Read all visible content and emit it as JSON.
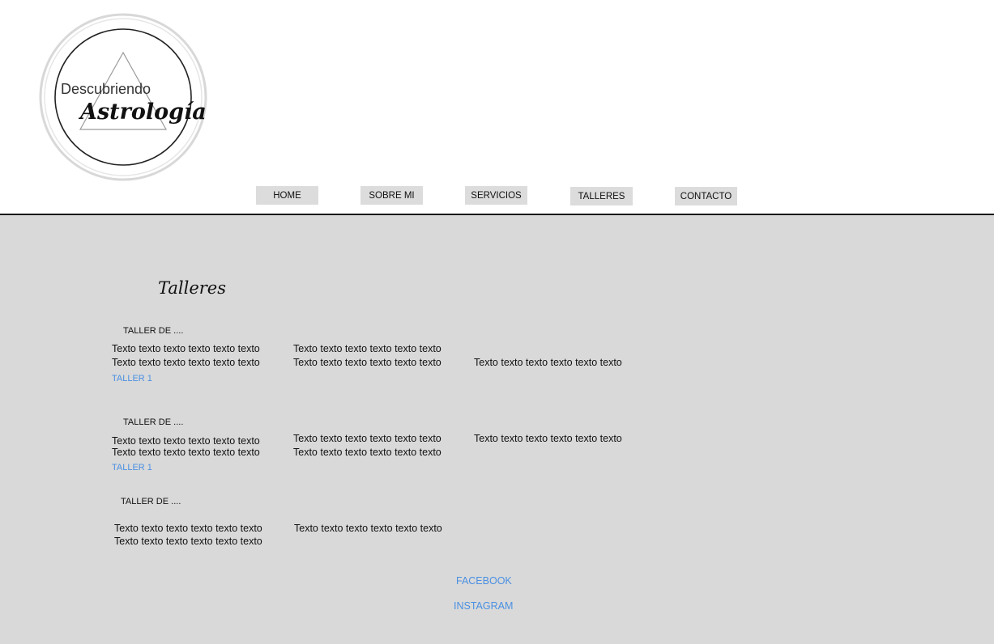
{
  "logo": {
    "line1": "Descubriendo",
    "line2": "Astrología"
  },
  "nav": {
    "home": "HOME",
    "sobre_mi": "SOBRE MI",
    "servicios": "SERVICIOS",
    "talleres": "TALLERES",
    "contacto": "CONTACTO"
  },
  "page": {
    "title": "Talleres"
  },
  "workshops": [
    {
      "heading": "TALLER DE ....",
      "line1": [
        "Texto texto texto texto texto texto",
        "Texto texto texto texto texto texto"
      ],
      "line2": [
        "Texto texto texto texto texto texto",
        "Texto texto texto texto texto texto",
        "Texto texto texto texto texto texto"
      ],
      "link": "TALLER 1"
    },
    {
      "heading": "TALLER DE ....",
      "line1": [
        "Texto texto texto texto texto texto",
        "Texto texto texto texto texto texto",
        "Texto texto texto texto texto texto"
      ],
      "line2": [
        "Texto texto texto texto texto texto",
        "Texto texto texto texto texto texto"
      ],
      "link": "TALLER 1"
    },
    {
      "heading": "TALLER DE ....",
      "line1": [
        "Texto texto texto texto texto texto",
        "Texto texto texto texto texto texto"
      ],
      "line2": [
        "Texto texto texto texto texto texto"
      ]
    }
  ],
  "social": {
    "facebook": "FACEBOOK",
    "instagram": "INSTAGRAM"
  },
  "colors": {
    "link": "#4a90e2",
    "main_bg": "#d9d9d9",
    "nav_bg": "#dcdcdc"
  }
}
